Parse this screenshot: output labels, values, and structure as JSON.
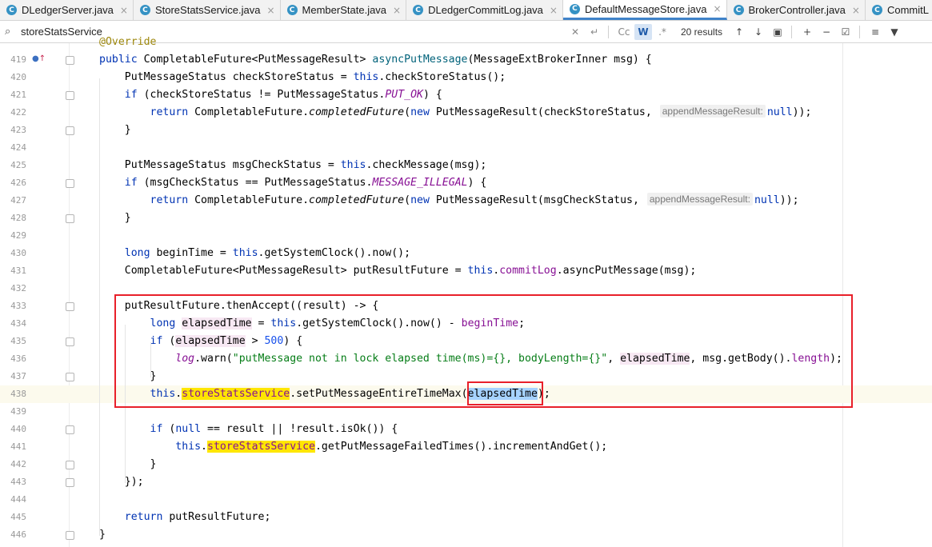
{
  "tabs": [
    {
      "label": "DLedgerServer.java",
      "icon": "class-icon",
      "active": false
    },
    {
      "label": "StoreStatsService.java",
      "icon": "class-icon",
      "active": false
    },
    {
      "label": "MemberState.java",
      "icon": "class-icon",
      "active": false
    },
    {
      "label": "DLedgerCommitLog.java",
      "icon": "class-icon",
      "active": false
    },
    {
      "label": "DefaultMessageStore.java",
      "icon": "class-icon",
      "active": true
    },
    {
      "label": "BrokerController.java",
      "icon": "class-icon",
      "active": false
    },
    {
      "label": "CommitL",
      "icon": "class-icon",
      "active": false
    }
  ],
  "search": {
    "query": "storeStatsService",
    "results_label": "20 results",
    "case_label": "Cc",
    "word_label": "W",
    "regex_label": ".*"
  },
  "colors": {
    "selection": "#a6d2ff",
    "search_match": "#ffe600",
    "highlight_box": "#e8202a",
    "keyword": "#0033b3",
    "field": "#871094",
    "string": "#067d17"
  },
  "lines": [
    {
      "num": "",
      "html": "<span style=\"color:#9e880d\">@Override</span>"
    },
    {
      "num": "419",
      "html": "<span class=\"kw\">public</span> CompletableFuture&lt;PutMessageResult&gt; <span class=\"mcall\">asyncPutMessage</span>(MessageExtBrokerInner msg) {"
    },
    {
      "num": "420",
      "html": "    PutMessageStatus checkStoreStatus = <span class=\"kw\">this</span>.checkStoreStatus();"
    },
    {
      "num": "421",
      "html": "    <span class=\"kw\">if</span> (checkStoreStatus != PutMessageStatus.<span class=\"stc\">PUT_OK</span>) {"
    },
    {
      "num": "422",
      "html": "        <span class=\"kw\">return</span> CompletableFuture.<span class=\"it\">completedFuture</span>(<span class=\"kw\">new</span> PutMessageResult(checkStoreStatus, <span class=\"hint\">appendMessageResult:</span><span class=\"kw\">null</span>));"
    },
    {
      "num": "423",
      "html": "    }"
    },
    {
      "num": "424",
      "html": ""
    },
    {
      "num": "425",
      "html": "    PutMessageStatus msgCheckStatus = <span class=\"kw\">this</span>.checkMessage(msg);"
    },
    {
      "num": "426",
      "html": "    <span class=\"kw\">if</span> (msgCheckStatus == PutMessageStatus.<span class=\"stc\">MESSAGE_ILLEGAL</span>) {"
    },
    {
      "num": "427",
      "html": "        <span class=\"kw\">return</span> CompletableFuture.<span class=\"it\">completedFuture</span>(<span class=\"kw\">new</span> PutMessageResult(msgCheckStatus, <span class=\"hint\">appendMessageResult:</span><span class=\"kw\">null</span>));"
    },
    {
      "num": "428",
      "html": "    }"
    },
    {
      "num": "429",
      "html": ""
    },
    {
      "num": "430",
      "html": "    <span class=\"kw\">long</span> beginTime = <span class=\"kw\">this</span>.getSystemClock().now();"
    },
    {
      "num": "431",
      "html": "    CompletableFuture&lt;PutMessageResult&gt; putResultFuture = <span class=\"kw\">this</span>.<span class=\"fld\">commitLog</span>.asyncPutMessage(msg);"
    },
    {
      "num": "432",
      "html": ""
    },
    {
      "num": "433",
      "html": "    putResultFuture.thenAccept((result) -&gt; {"
    },
    {
      "num": "434",
      "html": "        <span class=\"kw\">long</span> <span class=\"lv\">elapsedTime</span> = <span class=\"kw\">this</span>.getSystemClock().now() - <span class=\"fld\">beginTime</span>;"
    },
    {
      "num": "435",
      "html": "        <span class=\"kw\">if</span> (<span class=\"lv\">elapsedTime</span> &gt; <span class=\"num\">500</span>) {"
    },
    {
      "num": "436",
      "html": "            <span class=\"stc\">log</span>.warn(<span class=\"st\">\"putMessage not in lock elapsed time(ms)={}, bodyLength={}\"</span>, <span class=\"lv\">elapsedTime</span>, msg.getBody().<span class=\"fld\">length</span>);"
    },
    {
      "num": "437",
      "html": "        }"
    },
    {
      "num": "438",
      "html": "        <span class=\"kw\">this</span>.<span class=\"fld srch\">storeStatsService</span>.setPutMessageEntireTimeMax(<span class=\"sel\">elapsedTime</span>);",
      "current": true
    },
    {
      "num": "439",
      "html": ""
    },
    {
      "num": "440",
      "html": "        <span class=\"kw\">if</span> (<span class=\"kw\">null</span> == result || !result.isOk()) {"
    },
    {
      "num": "441",
      "html": "            <span class=\"kw\">this</span>.<span class=\"fld srch\">storeStatsService</span>.getPutMessageFailedTimes().incrementAndGet();"
    },
    {
      "num": "442",
      "html": "        }"
    },
    {
      "num": "443",
      "html": "    });"
    },
    {
      "num": "444",
      "html": ""
    },
    {
      "num": "445",
      "html": "    <span class=\"kw\">return</span> putResultFuture;"
    },
    {
      "num": "446",
      "html": "}"
    }
  ]
}
